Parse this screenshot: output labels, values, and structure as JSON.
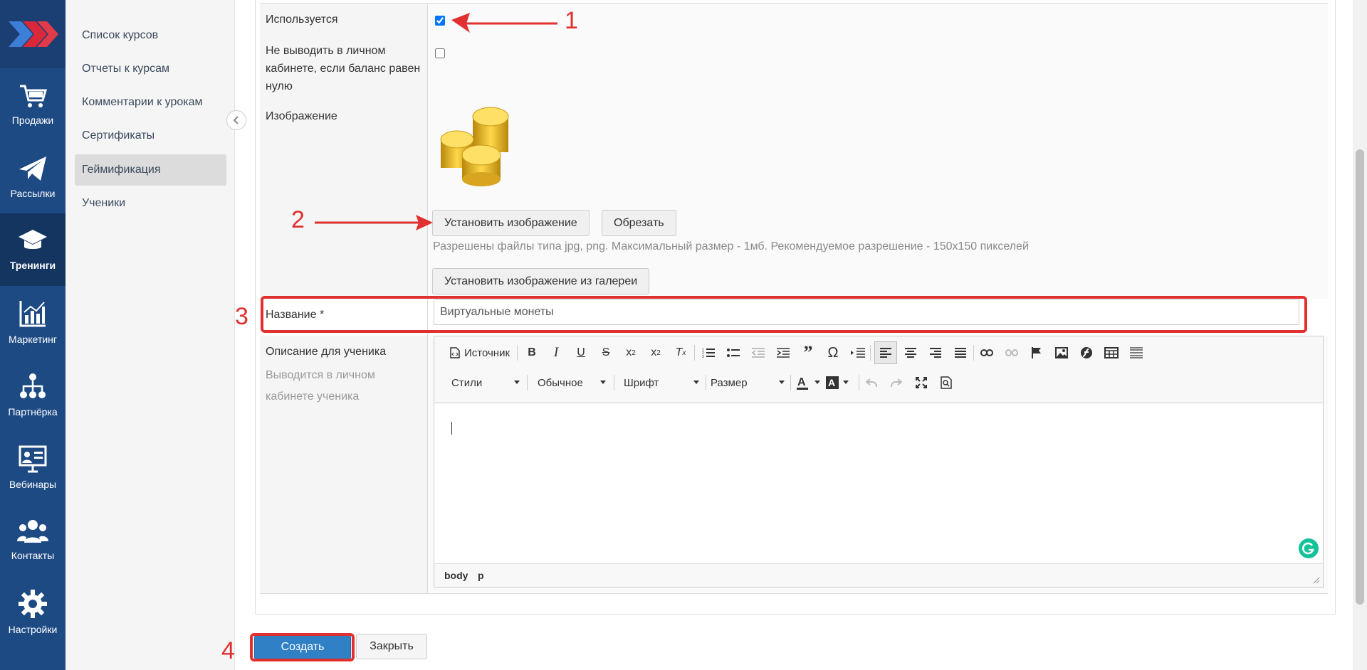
{
  "rail": {
    "items": [
      {
        "label": "Продажи",
        "icon": "cart-icon"
      },
      {
        "label": "Рассылки",
        "icon": "paper-plane-icon"
      },
      {
        "label": "Тренинги",
        "icon": "graduation-cap-icon"
      },
      {
        "label": "Маркетинг",
        "icon": "chart-icon"
      },
      {
        "label": "Партнёрка",
        "icon": "hierarchy-icon"
      },
      {
        "label": "Вебинары",
        "icon": "presentation-icon"
      },
      {
        "label": "Контакты",
        "icon": "users-icon"
      },
      {
        "label": "Настройки",
        "icon": "gear-icon"
      }
    ]
  },
  "subnav": {
    "items": [
      {
        "label": "Список курсов"
      },
      {
        "label": "Отчеты к курсам"
      },
      {
        "label": "Комментарии к урокам"
      },
      {
        "label": "Сертификаты"
      },
      {
        "label": "Геймификация"
      },
      {
        "label": "Ученики"
      }
    ],
    "active_index": 4
  },
  "form": {
    "used_label": "Используется",
    "used_checked": true,
    "hide_label": "Не выводить в личном кабинете, если баланс равен нулю",
    "hide_checked": false,
    "image_label": "Изображение",
    "set_image_button": "Установить изображение",
    "crop_button": "Обрезать",
    "image_hint": "Разрешены файлы типа jpg, png. Максимальный размер - 1мб. Рекомендуемое разрешение - 150х150 пикселей",
    "gallery_button": "Установить изображение из галереи",
    "name_label": "Название *",
    "name_value": "Виртуальные монеты",
    "desc_label": "Описание для ученика",
    "desc_hint": "Выводится в личном кабинете ученика"
  },
  "editor": {
    "source_label": "Источник",
    "styles_label": "Стили",
    "format_label": "Обычное",
    "font_label": "Шрифт",
    "size_label": "Размер",
    "path": [
      "body",
      "p"
    ]
  },
  "actions": {
    "create_button": "Создать",
    "close_button": "Закрыть"
  },
  "annotations": [
    "1",
    "2",
    "3",
    "4"
  ],
  "colors": {
    "rail_bg": "#1e4a84",
    "accent_red": "#e03030",
    "create_btn": "#2f80c4"
  }
}
